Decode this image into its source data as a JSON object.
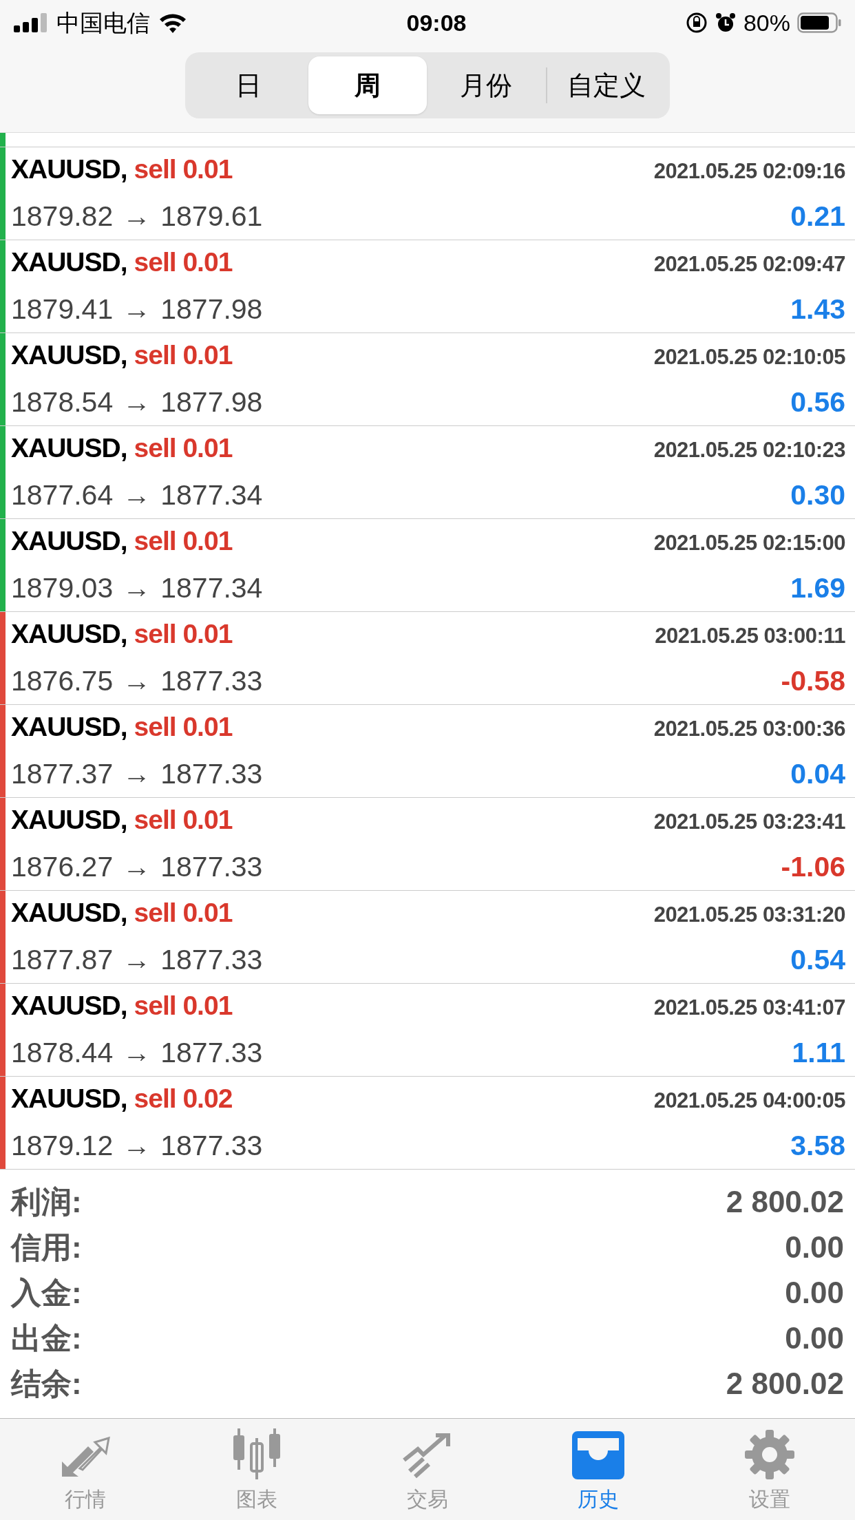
{
  "status_bar": {
    "carrier": "中国电信",
    "time": "09:08",
    "battery": "80%"
  },
  "segments": [
    {
      "label": "日",
      "selected": false
    },
    {
      "label": "周",
      "selected": true
    },
    {
      "label": "月份",
      "selected": false
    },
    {
      "label": "自定义",
      "selected": false
    }
  ],
  "top_partial_row": {
    "color": "#22b14c"
  },
  "deals": [
    {
      "symbol": "XAUUSD,",
      "side": "sell 0.01",
      "time": "2021.05.25 02:09:16",
      "open": "1879.82",
      "arrow": "→",
      "close": "1879.61",
      "profit": "0.21",
      "loss": false,
      "color": "#22b14c"
    },
    {
      "symbol": "XAUUSD,",
      "side": "sell 0.01",
      "time": "2021.05.25 02:09:47",
      "open": "1879.41",
      "arrow": "→",
      "close": "1877.98",
      "profit": "1.43",
      "loss": false,
      "color": "#22b14c"
    },
    {
      "symbol": "XAUUSD,",
      "side": "sell 0.01",
      "time": "2021.05.25 02:10:05",
      "open": "1878.54",
      "arrow": "→",
      "close": "1877.98",
      "profit": "0.56",
      "loss": false,
      "color": "#22b14c"
    },
    {
      "symbol": "XAUUSD,",
      "side": "sell 0.01",
      "time": "2021.05.25 02:10:23",
      "open": "1877.64",
      "arrow": "→",
      "close": "1877.34",
      "profit": "0.30",
      "loss": false,
      "color": "#22b14c"
    },
    {
      "symbol": "XAUUSD,",
      "side": "sell 0.01",
      "time": "2021.05.25 02:15:00",
      "open": "1879.03",
      "arrow": "→",
      "close": "1877.34",
      "profit": "1.69",
      "loss": false,
      "color": "#22b14c"
    },
    {
      "symbol": "XAUUSD,",
      "side": "sell 0.01",
      "time": "2021.05.25 03:00:11",
      "open": "1876.75",
      "arrow": "→",
      "close": "1877.33",
      "profit": "-0.58",
      "loss": true,
      "color": "#e0493c"
    },
    {
      "symbol": "XAUUSD,",
      "side": "sell 0.01",
      "time": "2021.05.25 03:00:36",
      "open": "1877.37",
      "arrow": "→",
      "close": "1877.33",
      "profit": "0.04",
      "loss": false,
      "color": "#e0493c"
    },
    {
      "symbol": "XAUUSD,",
      "side": "sell 0.01",
      "time": "2021.05.25 03:23:41",
      "open": "1876.27",
      "arrow": "→",
      "close": "1877.33",
      "profit": "-1.06",
      "loss": true,
      "color": "#e0493c"
    },
    {
      "symbol": "XAUUSD,",
      "side": "sell 0.01",
      "time": "2021.05.25 03:31:20",
      "open": "1877.87",
      "arrow": "→",
      "close": "1877.33",
      "profit": "0.54",
      "loss": false,
      "color": "#e0493c"
    },
    {
      "symbol": "XAUUSD,",
      "side": "sell 0.01",
      "time": "2021.05.25 03:41:07",
      "open": "1878.44",
      "arrow": "→",
      "close": "1877.33",
      "profit": "1.11",
      "loss": false,
      "color": "#e0493c"
    },
    {
      "symbol": "XAUUSD,",
      "side": "sell 0.02",
      "time": "2021.05.25 04:00:05",
      "open": "1879.12",
      "arrow": "→",
      "close": "1877.33",
      "profit": "3.58",
      "loss": false,
      "color": "#e0493c"
    }
  ],
  "summary": [
    {
      "label": "利润:",
      "value": "2 800.02"
    },
    {
      "label": "信用:",
      "value": "0.00"
    },
    {
      "label": "入金:",
      "value": "0.00"
    },
    {
      "label": "出金:",
      "value": "0.00"
    },
    {
      "label": "结余:",
      "value": "2 800.02"
    }
  ],
  "tab_bar": [
    {
      "kind": "quotes",
      "label": "行情",
      "selected": false
    },
    {
      "kind": "chart",
      "label": "图表",
      "selected": false
    },
    {
      "kind": "trade",
      "label": "交易",
      "selected": false
    },
    {
      "kind": "history",
      "label": "历史",
      "selected": true
    },
    {
      "kind": "settings",
      "label": "设置",
      "selected": false
    }
  ]
}
